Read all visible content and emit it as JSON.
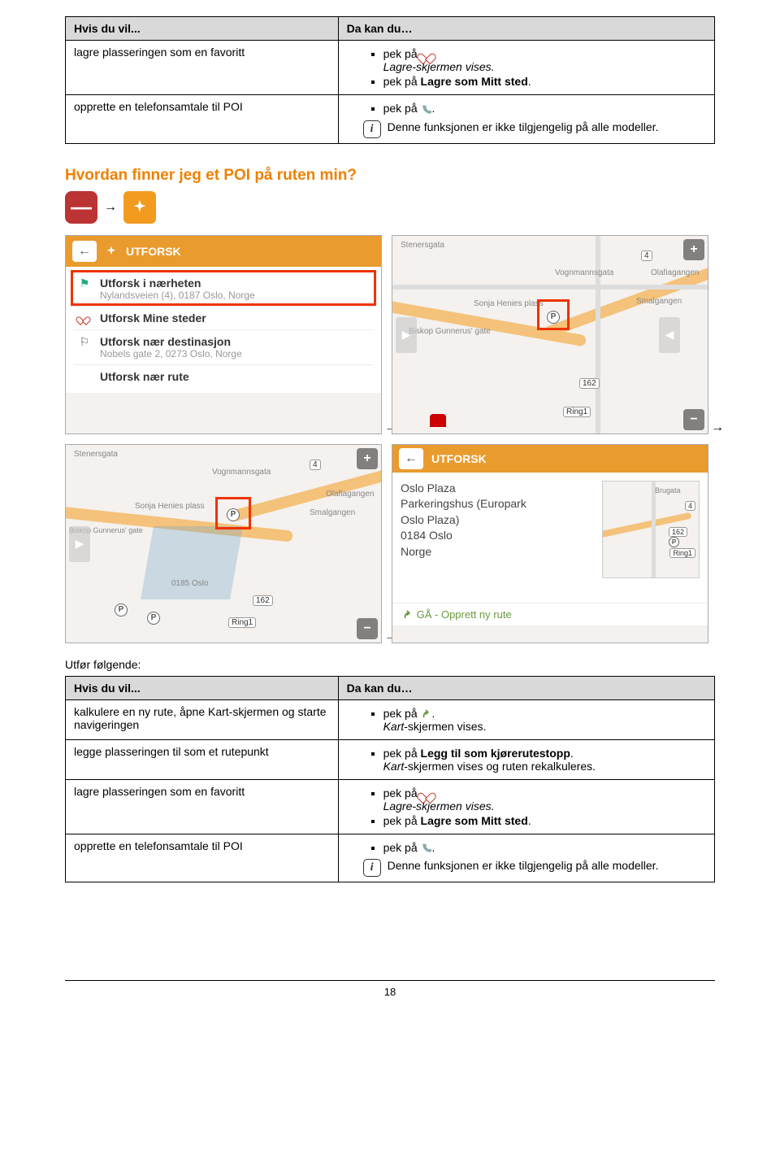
{
  "table1": {
    "header_left": "Hvis du vil...",
    "header_right": "Da kan du…",
    "row1_left": "lagre plasseringen som en favoritt",
    "row1_b1": "pek på ",
    "row1_b1_end": ".",
    "row1_b1_sub": "Lagre-skjermen vises.",
    "row1_b2_prefix": "pek på ",
    "row1_b2_bold": "Lagre som Mitt sted",
    "row1_b2_end": ".",
    "row2_left": "opprette en telefonsamtale til POI",
    "row2_b1": "pek på ",
    "row2_b1_end": ".",
    "row2_info": "Denne funksjonen er ikke tilgjengelig på alle modeller."
  },
  "section_heading": "Hvordan finner jeg et POI på ruten min?",
  "panelA": {
    "title": "UTFORSK",
    "item1_title": "Utforsk i nærheten",
    "item1_sub": "Nylandsveien (4), 0187 Oslo, Norge",
    "item2_title": "Utforsk Mine steder",
    "item3_title": "Utforsk nær destinasjon",
    "item3_sub": "Nobels gate 2, 0273 Oslo, Norge",
    "item4_title": "Utforsk nær rute"
  },
  "map_labels": {
    "stenersgata": "Stenersgata",
    "vognmannsgata": "Vognmannsgata",
    "olafiagangen": "Olafiagangen",
    "sonja": "Sonja Henies plass",
    "gunnerus": "Biskop Gunnerus' gate",
    "smalgangen": "Smalgangen",
    "ring1": "Ring1",
    "n162": "162",
    "n4": "4",
    "oslo0185": "0185 Oslo",
    "brugata": "Brugata"
  },
  "panelD": {
    "title": "UTFORSK",
    "line1": "Oslo Plaza",
    "line2": "Parkeringshus (Europark",
    "line3": "Oslo Plaza)",
    "line4": "0184 Oslo",
    "line5": "Norge",
    "action": "GÅ - Opprett ny rute"
  },
  "utfor_label": "Utfør følgende:",
  "table2": {
    "header_left": "Hvis du vil...",
    "header_right": "Da kan du…",
    "row1_left": "kalkulere en ny rute, åpne Kart-skjermen og starte navigeringen",
    "row1_b1": "pek på ",
    "row1_b1_end": ".",
    "row1_b1_sub_italic": "Kart",
    "row1_b1_sub_rest": "-skjermen vises.",
    "row2_left": "legge plasseringen til som et rutepunkt",
    "row2_b1_prefix": "pek på ",
    "row2_b1_bold": "Legg til som kjørerutestopp",
    "row2_b1_end": ".",
    "row2_b1_sub_italic": "Kart",
    "row2_b1_sub_rest": "-skjermen vises og ruten rekalkuleres.",
    "row3_left": "lagre plasseringen som en favoritt",
    "row3_b1": "pek på ",
    "row3_b1_end": ".",
    "row3_b1_sub": "Lagre-skjermen vises.",
    "row3_b2_prefix": "pek på ",
    "row3_b2_bold": "Lagre som Mitt sted",
    "row3_b2_end": ".",
    "row4_left": "opprette en telefonsamtale til POI",
    "row4_b1": "pek på ",
    "row4_b1_end": ".",
    "row4_info": "Denne funksjonen er ikke tilgjengelig på alle modeller."
  },
  "arrow": "→",
  "page_number": "18"
}
